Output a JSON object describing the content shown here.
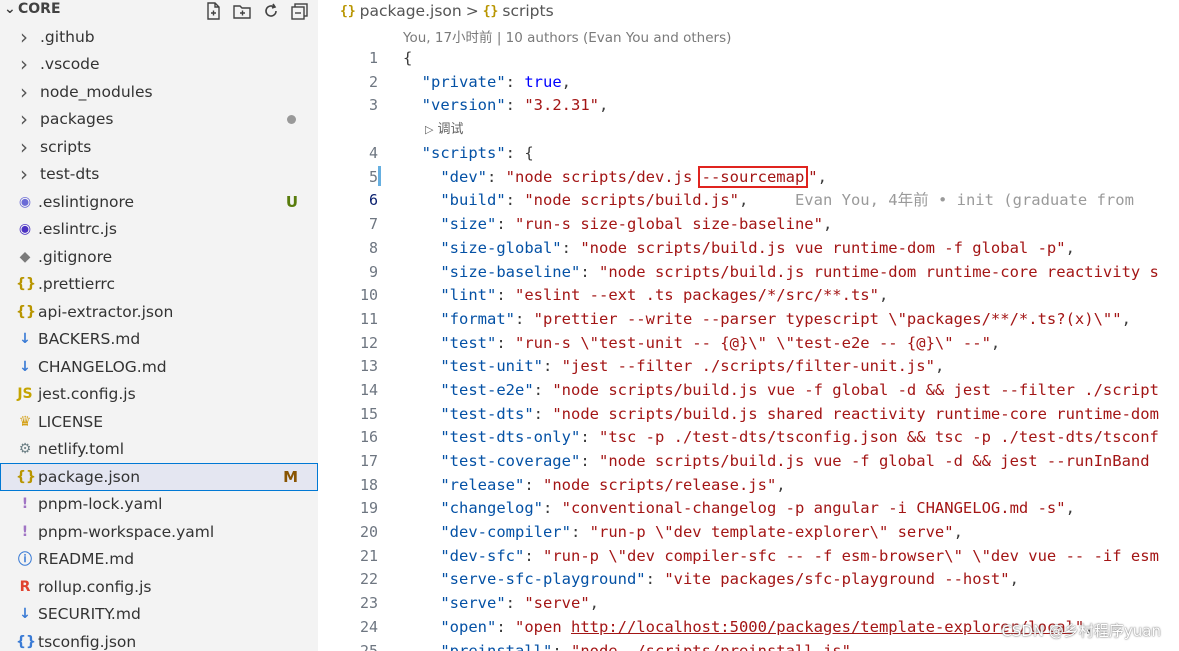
{
  "explorer": {
    "title": "CORE",
    "actions": [
      "new-file-icon",
      "new-folder-icon",
      "refresh-icon",
      "collapse-all-icon"
    ],
    "items": [
      {
        "label": ".github",
        "type": "folder"
      },
      {
        "label": ".vscode",
        "type": "folder"
      },
      {
        "label": "node_modules",
        "type": "folder"
      },
      {
        "label": "packages",
        "type": "folder",
        "badge": "dot"
      },
      {
        "label": "scripts",
        "type": "folder"
      },
      {
        "label": "test-dts",
        "type": "folder"
      },
      {
        "label": ".eslintignore",
        "icon": "◉",
        "icon_color": "#6b6bd6",
        "badge": "U"
      },
      {
        "label": ".eslintrc.js",
        "icon": "◉",
        "icon_color": "#4b32c3"
      },
      {
        "label": ".gitignore",
        "icon": "◆",
        "icon_color": "#7a7a7a"
      },
      {
        "label": ".prettierrc",
        "icon": "{}",
        "icon_color": "#b89500"
      },
      {
        "label": "api-extractor.json",
        "icon": "{}",
        "icon_color": "#b89500"
      },
      {
        "label": "BACKERS.md",
        "icon": "↓",
        "icon_color": "#3a7bd5"
      },
      {
        "label": "CHANGELOG.md",
        "icon": "↓",
        "icon_color": "#3a7bd5"
      },
      {
        "label": "jest.config.js",
        "icon": "JS",
        "icon_color": "#c5a400"
      },
      {
        "label": "LICENSE",
        "icon": "♛",
        "icon_color": "#d4a017"
      },
      {
        "label": "netlify.toml",
        "icon": "⚙",
        "icon_color": "#6d8086"
      },
      {
        "label": "package.json",
        "icon": "{}",
        "icon_color": "#b89500",
        "badge": "M",
        "selected": true
      },
      {
        "label": "pnpm-lock.yaml",
        "icon": "!",
        "icon_color": "#a074c4"
      },
      {
        "label": "pnpm-workspace.yaml",
        "icon": "!",
        "icon_color": "#a074c4"
      },
      {
        "label": "README.md",
        "icon": "ⓘ",
        "icon_color": "#3a7bd5"
      },
      {
        "label": "rollup.config.js",
        "icon": "R",
        "icon_color": "#e0412e"
      },
      {
        "label": "SECURITY.md",
        "icon": "↓",
        "icon_color": "#3a7bd5"
      },
      {
        "label": "tsconfig.json",
        "icon": "{}",
        "icon_color": "#3a7bd5"
      }
    ]
  },
  "editor": {
    "breadcrumb": {
      "file": "package.json",
      "separator": ">",
      "symbol": "scripts",
      "icon": "{}"
    },
    "blame_header": "You, 17小时前 | 10 authors (Evan You and others)",
    "code_lens": "调试",
    "inline_blame": "Evan You, 4年前 • init (graduate from",
    "highlighted_token": "--sourcemap",
    "active_line": 6,
    "modified_line": 5,
    "lines": [
      {
        "n": 1,
        "indent": 0,
        "raw": "{"
      },
      {
        "n": 2,
        "indent": 1,
        "key": "private",
        "val": "true",
        "val_type": "kw",
        "end": ","
      },
      {
        "n": 3,
        "indent": 1,
        "key": "version",
        "val": "3.2.31",
        "end": ","
      },
      {
        "lens": true
      },
      {
        "n": 4,
        "indent": 1,
        "key": "scripts",
        "raw_after": ": {"
      },
      {
        "n": 5,
        "indent": 2,
        "key": "dev",
        "val_pre": "node scripts/dev.js ",
        "val_hl": "--sourcemap",
        "end": ","
      },
      {
        "n": 6,
        "indent": 2,
        "key": "build",
        "val": "node scripts/build.js",
        "end": ",",
        "blame": true
      },
      {
        "n": 7,
        "indent": 2,
        "key": "size",
        "val": "run-s size-global size-baseline",
        "end": ","
      },
      {
        "n": 8,
        "indent": 2,
        "key": "size-global",
        "val": "node scripts/build.js vue runtime-dom -f global -p",
        "end": ","
      },
      {
        "n": 9,
        "indent": 2,
        "key": "size-baseline",
        "val": "node scripts/build.js runtime-dom runtime-core reactivity s",
        "end": ""
      },
      {
        "n": 10,
        "indent": 2,
        "key": "lint",
        "val": "eslint --ext .ts packages/*/src/**.ts",
        "end": ","
      },
      {
        "n": 11,
        "indent": 2,
        "key": "format",
        "val": "prettier --write --parser typescript \\\"packages/**/*.ts?(x)\\\"",
        "end": ","
      },
      {
        "n": 12,
        "indent": 2,
        "key": "test",
        "val": "run-s \\\"test-unit -- {@}\\\" \\\"test-e2e -- {@}\\\" --",
        "end": ","
      },
      {
        "n": 13,
        "indent": 2,
        "key": "test-unit",
        "val": "jest --filter ./scripts/filter-unit.js",
        "end": ","
      },
      {
        "n": 14,
        "indent": 2,
        "key": "test-e2e",
        "val": "node scripts/build.js vue -f global -d && jest --filter ./script",
        "end": ""
      },
      {
        "n": 15,
        "indent": 2,
        "key": "test-dts",
        "val": "node scripts/build.js shared reactivity runtime-core runtime-dom",
        "end": ""
      },
      {
        "n": 16,
        "indent": 2,
        "key": "test-dts-only",
        "val": "tsc -p ./test-dts/tsconfig.json && tsc -p ./test-dts/tsconf",
        "end": ""
      },
      {
        "n": 17,
        "indent": 2,
        "key": "test-coverage",
        "val": "node scripts/build.js vue -f global -d && jest --runInBand",
        "end": ""
      },
      {
        "n": 18,
        "indent": 2,
        "key": "release",
        "val": "node scripts/release.js",
        "end": ","
      },
      {
        "n": 19,
        "indent": 2,
        "key": "changelog",
        "val": "conventional-changelog -p angular -i CHANGELOG.md -s",
        "end": ","
      },
      {
        "n": 20,
        "indent": 2,
        "key": "dev-compiler",
        "val": "run-p \\\"dev template-explorer\\\" serve",
        "end": ","
      },
      {
        "n": 21,
        "indent": 2,
        "key": "dev-sfc",
        "val": "run-p \\\"dev compiler-sfc -- -f esm-browser\\\" \\\"dev vue -- -if esm",
        "end": ""
      },
      {
        "n": 22,
        "indent": 2,
        "key": "serve-sfc-playground",
        "val": "vite packages/sfc-playground --host",
        "end": ","
      },
      {
        "n": 23,
        "indent": 2,
        "key": "serve",
        "val": "serve",
        "end": ","
      },
      {
        "n": 24,
        "indent": 2,
        "key": "open",
        "val_pre": "open ",
        "val_link": "http://localhost:5000/packages/template-explorer/local",
        "end": "\","
      },
      {
        "n": 25,
        "indent": 2,
        "key": "preinstall",
        "val": "node ./scripts/preinstall.js",
        "end": ","
      }
    ]
  },
  "watermark": "CSDN @乡村程序yuan"
}
